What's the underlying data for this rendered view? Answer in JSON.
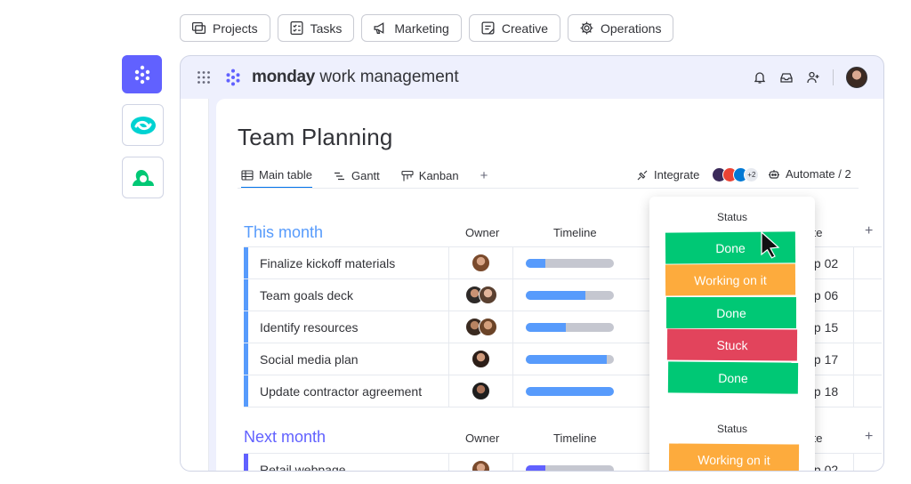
{
  "categories": [
    {
      "label": "Projects",
      "icon": "projects-icon"
    },
    {
      "label": "Tasks",
      "icon": "tasks-icon"
    },
    {
      "label": "Marketing",
      "icon": "megaphone-icon"
    },
    {
      "label": "Creative",
      "icon": "creative-icon"
    },
    {
      "label": "Operations",
      "icon": "gear-icon"
    }
  ],
  "rail": [
    {
      "name": "monday-app",
      "color": "#6161ff"
    },
    {
      "name": "sync-app",
      "color": "#00d2d2"
    },
    {
      "name": "loop-app",
      "color": "#00c875"
    }
  ],
  "brand": {
    "bold": "monday",
    "light": "work management"
  },
  "board": {
    "title": "Team Planning"
  },
  "tabs": [
    {
      "label": "Main table",
      "active": true
    },
    {
      "label": "Gantt",
      "active": false
    },
    {
      "label": "Kanban",
      "active": false
    },
    {
      "label": "+",
      "active": false
    }
  ],
  "toolbar": {
    "integrate_label": "Integrate",
    "integrate_extra": "+2",
    "automate_label": "Automate / 2"
  },
  "columns": {
    "owner": "Owner",
    "timeline": "Timeline",
    "status": "Status",
    "date": "Date",
    "add": "+"
  },
  "groups": [
    {
      "title": "This month",
      "color": "#579bfc",
      "items": [
        {
          "name": "Finalize kickoff materials",
          "timeline_progress": 0.22,
          "status": "Done",
          "date": "Sep 02"
        },
        {
          "name": "Team goals deck",
          "timeline_progress": 0.68,
          "status": "Working on it",
          "date": "Sep 06"
        },
        {
          "name": "Identify resources",
          "timeline_progress": 0.45,
          "status": "Done",
          "date": "Sep 15"
        },
        {
          "name": "Social media plan",
          "timeline_progress": 0.92,
          "status": "Stuck",
          "date": "Sep 17"
        },
        {
          "name": "Update contractor agreement",
          "timeline_progress": 1.0,
          "status": "Done",
          "date": "Sep 18"
        }
      ]
    },
    {
      "title": "Next month",
      "color": "#6161ff",
      "items": [
        {
          "name": "Retail webpage",
          "timeline_progress": 0.22,
          "status": "Working on it",
          "date": "Sep 02"
        }
      ]
    }
  ],
  "status_colors": {
    "Done": "#00c875",
    "Working on it": "#fdab3d",
    "Stuck": "#e2445c"
  }
}
